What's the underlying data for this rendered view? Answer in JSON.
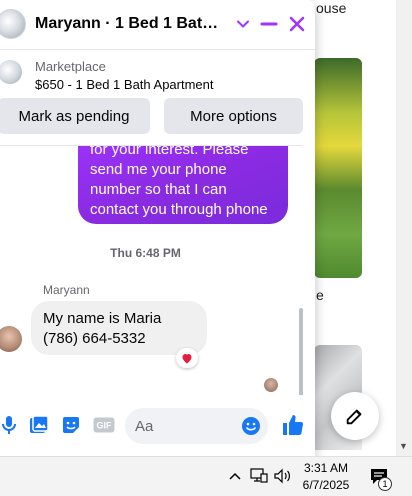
{
  "background": {
    "partial_text_1": "ouse",
    "partial_text_2": "e"
  },
  "chat": {
    "title": "Maryann · 1 Bed 1 Bath Ap...",
    "listing_kicker": "Marketplace",
    "listing_title": "$650 - 1 Bed 1 Bath Apartment",
    "mark_pending_label": "Mark as pending",
    "more_options_label": "More options",
    "outgoing_message": {
      "lines": [
        "for your interest. Please",
        "send me your phone",
        "number so that I can",
        "contact you through phone"
      ]
    },
    "timestamp": "Thu 6:48 PM",
    "sender_name": "Maryann",
    "incoming_message": {
      "lines": [
        "My name is Maria",
        "(786) 664-5332"
      ]
    },
    "reaction": "heart",
    "input_placeholder": "Aa"
  },
  "icons": {
    "chevron": "chevron-down-icon",
    "minimize": "minimize-icon",
    "close": "close-icon",
    "mic": "microphone-icon",
    "photo": "photo-icon",
    "sticker": "sticker-icon",
    "gif": "gif-icon",
    "emoji": "emoji-icon",
    "like": "thumbs-up-icon",
    "compose": "compose-icon"
  },
  "colors": {
    "accent": "#a033ff",
    "messenger_purple": "#8a2be2",
    "heart": "#e41e3f"
  },
  "taskbar": {
    "time": "3:31 AM",
    "date": "6/7/2025",
    "notification_count": "1"
  }
}
